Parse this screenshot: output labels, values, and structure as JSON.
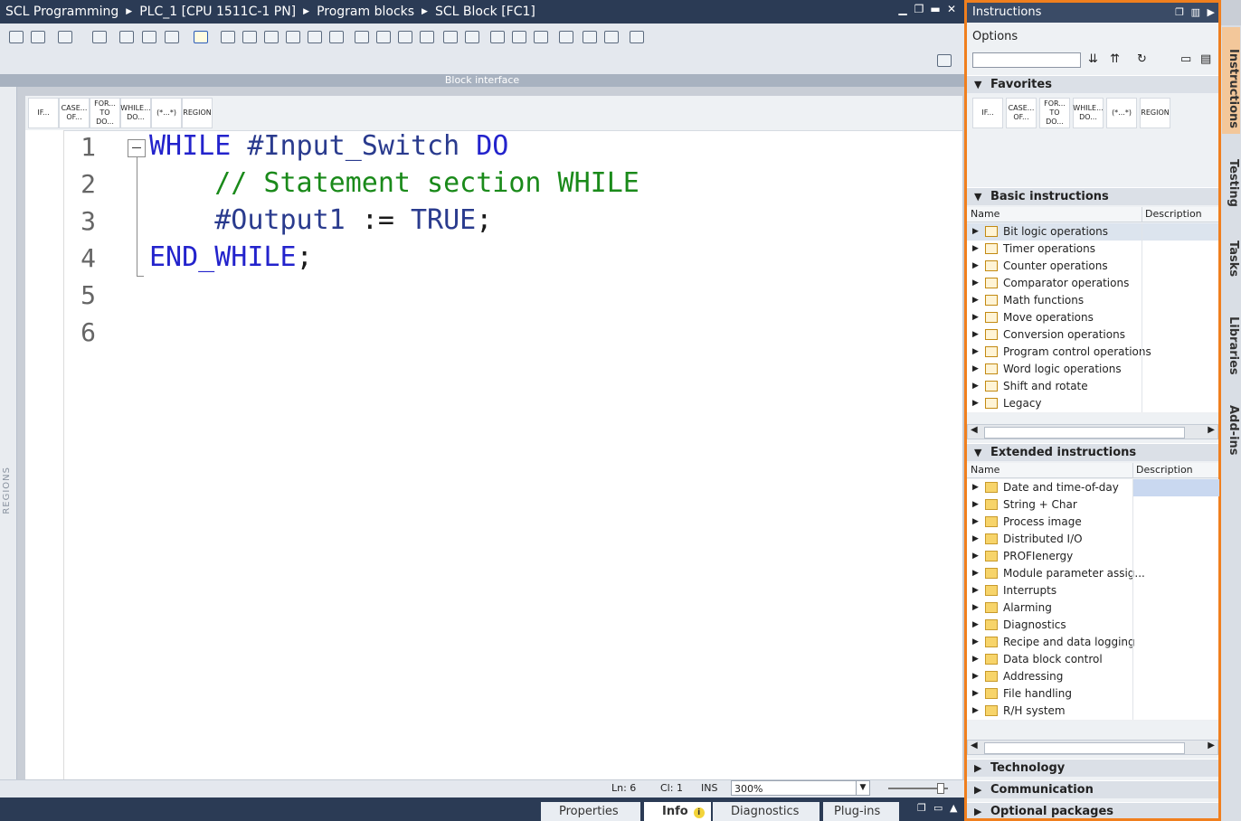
{
  "titlebar": {
    "crumbs": [
      "SCL Programming",
      "PLC_1 [CPU 1511C-1 PN]",
      "Program blocks",
      "SCL Block [FC1]"
    ]
  },
  "editor": {
    "block_interface_label": "Block interface",
    "regions_label": "REGIONS",
    "favorites": [
      "IF...",
      "CASE... OF...",
      "FOR... TO DO...",
      "WHILE... DO...",
      "(*...*)",
      "REGION"
    ],
    "lines": [
      {
        "num": "1",
        "tokens": [
          {
            "t": "WHILE",
            "c": "kw"
          },
          {
            "t": " #Input_Switch ",
            "c": "var"
          },
          {
            "t": "DO",
            "c": "kw"
          }
        ]
      },
      {
        "num": "2",
        "tokens": [
          {
            "t": "    // Statement section WHILE",
            "c": "cm"
          }
        ]
      },
      {
        "num": "3",
        "tokens": [
          {
            "t": "    #Output1 ",
            "c": "var"
          },
          {
            "t": ":= ",
            "c": "plain"
          },
          {
            "t": "TRUE",
            "c": "bool"
          },
          {
            "t": ";",
            "c": "plain"
          }
        ]
      },
      {
        "num": "4",
        "tokens": [
          {
            "t": "END_WHILE",
            "c": "kw"
          },
          {
            "t": ";",
            "c": "plain"
          }
        ]
      },
      {
        "num": "5",
        "tokens": []
      },
      {
        "num": "6",
        "tokens": []
      }
    ]
  },
  "status": {
    "ln": "Ln: 6",
    "cl": "Cl: 1",
    "mode": "INS",
    "zoom": "300%"
  },
  "bottom_tabs": {
    "properties": "Properties",
    "info": "Info",
    "diagnostics": "Diagnostics",
    "plugins": "Plug-ins"
  },
  "instructions": {
    "title": "Instructions",
    "options_label": "Options",
    "favorites_header": "Favorites",
    "favorites": [
      "IF...",
      "CASE... OF...",
      "FOR... TO DO...",
      "WHILE... DO...",
      "(*...*)",
      "REGION"
    ],
    "basic_header": "Basic instructions",
    "col_name": "Name",
    "col_desc": "Description",
    "basic_items": [
      "Bit logic operations",
      "Timer operations",
      "Counter operations",
      "Comparator operations",
      "Math functions",
      "Move operations",
      "Conversion operations",
      "Program control operations",
      "Word logic operations",
      "Shift and rotate",
      "Legacy"
    ],
    "extended_header": "Extended instructions",
    "extended_items": [
      "Date and time-of-day",
      "String + Char",
      "Process image",
      "Distributed I/O",
      "PROFIenergy",
      "Module parameter assig...",
      "Interrupts",
      "Alarming",
      "Diagnostics",
      "Recipe and data logging",
      "Data block control",
      "Addressing",
      "File handling",
      "R/H system"
    ],
    "technology_header": "Technology",
    "communication_header": "Communication",
    "optional_header": "Optional packages"
  },
  "side_tabs": [
    "Instructions",
    "Testing",
    "Tasks",
    "Libraries",
    "Add-ins"
  ],
  "colors": {
    "accent": "#f07f1e",
    "titlebar": "#2b3b55",
    "keyword": "#2323cc",
    "comment": "#1a8a1a"
  }
}
